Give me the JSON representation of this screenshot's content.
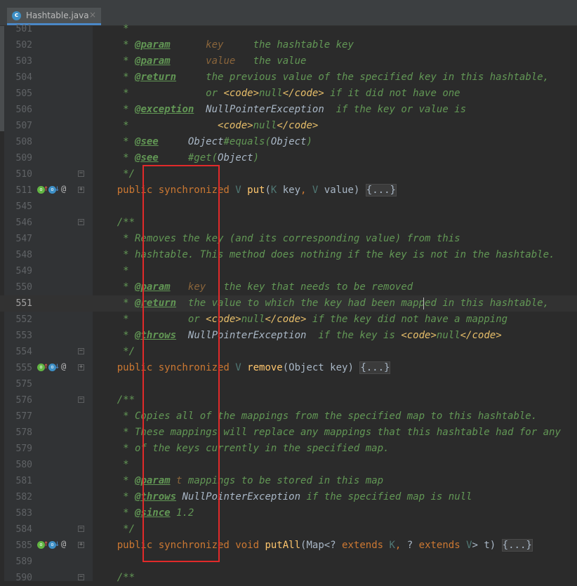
{
  "tab": {
    "filename": "Hashtable.java",
    "icon": "java-class-icon",
    "close": "×"
  },
  "colors": {
    "comment": "#629755",
    "keyword": "#cc7832",
    "method": "#ffc66d",
    "param": "#8a653b",
    "html_tag": "#e8bf6a",
    "highlight_box": "#e12a2a"
  },
  "lines": [
    {
      "num": "501",
      "tokens": [
        {
          "t": "     *",
          "c": "c"
        }
      ]
    },
    {
      "num": "502",
      "tokens": [
        {
          "t": "     * ",
          "c": "c"
        },
        {
          "t": "@param",
          "c": "tag"
        },
        {
          "t": "      ",
          "c": "c"
        },
        {
          "t": "key",
          "c": "pn"
        },
        {
          "t": "     the hashtable key",
          "c": "c"
        }
      ]
    },
    {
      "num": "503",
      "tokens": [
        {
          "t": "     * ",
          "c": "c"
        },
        {
          "t": "@param",
          "c": "tag"
        },
        {
          "t": "      ",
          "c": "c"
        },
        {
          "t": "value",
          "c": "pn"
        },
        {
          "t": "   the value",
          "c": "c"
        }
      ]
    },
    {
      "num": "504",
      "tokens": [
        {
          "t": "     * ",
          "c": "c"
        },
        {
          "t": "@return",
          "c": "tag"
        },
        {
          "t": "     the previous value of the specified key in this hashtable,",
          "c": "c"
        }
      ]
    },
    {
      "num": "505",
      "tokens": [
        {
          "t": "     *             or ",
          "c": "c"
        },
        {
          "t": "<code>",
          "c": "ht"
        },
        {
          "t": "null",
          "c": "c"
        },
        {
          "t": "</code>",
          "c": "ht"
        },
        {
          "t": " if it did not have one",
          "c": "c"
        }
      ]
    },
    {
      "num": "506",
      "tokens": [
        {
          "t": "     * ",
          "c": "c"
        },
        {
          "t": "@exception",
          "c": "tag"
        },
        {
          "t": "  ",
          "c": "c"
        },
        {
          "t": "NullPointerException",
          "c": "ref"
        },
        {
          "t": "  if the key or value is",
          "c": "c"
        }
      ]
    },
    {
      "num": "507",
      "tokens": [
        {
          "t": "     *               ",
          "c": "c"
        },
        {
          "t": "<code>",
          "c": "ht"
        },
        {
          "t": "null",
          "c": "c"
        },
        {
          "t": "</code>",
          "c": "ht"
        }
      ]
    },
    {
      "num": "508",
      "tokens": [
        {
          "t": "     * ",
          "c": "c"
        },
        {
          "t": "@see",
          "c": "tag"
        },
        {
          "t": "     ",
          "c": "c"
        },
        {
          "t": "Object",
          "c": "ref"
        },
        {
          "t": "#equals(",
          "c": "c"
        },
        {
          "t": "Object",
          "c": "ref"
        },
        {
          "t": ")",
          "c": "c"
        }
      ]
    },
    {
      "num": "509",
      "tokens": [
        {
          "t": "     * ",
          "c": "c"
        },
        {
          "t": "@see",
          "c": "tag"
        },
        {
          "t": "     #get(",
          "c": "c"
        },
        {
          "t": "Object",
          "c": "ref"
        },
        {
          "t": ")",
          "c": "c"
        }
      ]
    },
    {
      "num": "510",
      "fold": "−",
      "tokens": [
        {
          "t": "     */",
          "c": "c"
        }
      ]
    },
    {
      "num": "511",
      "icons": true,
      "fold": "+",
      "tokens": [
        {
          "t": "    public ",
          "c": "kw"
        },
        {
          "t": "synchronized ",
          "c": "kw"
        },
        {
          "t": "V ",
          "c": "tp"
        },
        {
          "t": "put",
          "c": "fn"
        },
        {
          "t": "(",
          "c": "plain"
        },
        {
          "t": "K ",
          "c": "tp"
        },
        {
          "t": "key",
          "c": "plain"
        },
        {
          "t": ", ",
          "c": "kw"
        },
        {
          "t": "V ",
          "c": "tp"
        },
        {
          "t": "value) ",
          "c": "plain"
        },
        {
          "t": "{...}",
          "c": "ph"
        }
      ]
    },
    {
      "num": "545",
      "tokens": []
    },
    {
      "num": "546",
      "fold": "−",
      "tokens": [
        {
          "t": "    /**",
          "c": "c"
        }
      ]
    },
    {
      "num": "547",
      "tokens": [
        {
          "t": "     * Removes the key (and its corresponding value) from this",
          "c": "c"
        }
      ]
    },
    {
      "num": "548",
      "tokens": [
        {
          "t": "     * hashtable. This method does nothing if the key is not in the hashtable.",
          "c": "c"
        }
      ]
    },
    {
      "num": "549",
      "tokens": [
        {
          "t": "     *",
          "c": "c"
        }
      ]
    },
    {
      "num": "550",
      "tokens": [
        {
          "t": "     * ",
          "c": "c"
        },
        {
          "t": "@param",
          "c": "tag"
        },
        {
          "t": "   ",
          "c": "c"
        },
        {
          "t": "key",
          "c": "pn"
        },
        {
          "t": "   the key that needs to be removed",
          "c": "c"
        }
      ]
    },
    {
      "num": "551",
      "current": true,
      "tokens": [
        {
          "t": "     * ",
          "c": "c"
        },
        {
          "t": "@return",
          "c": "tag"
        },
        {
          "t": "  the value to which the key had been mapped in this hashtable,",
          "c": "c"
        }
      ]
    },
    {
      "num": "552",
      "tokens": [
        {
          "t": "     *          or ",
          "c": "c"
        },
        {
          "t": "<code>",
          "c": "ht"
        },
        {
          "t": "null",
          "c": "c"
        },
        {
          "t": "</code>",
          "c": "ht"
        },
        {
          "t": " if the key did not have a mapping",
          "c": "c"
        }
      ]
    },
    {
      "num": "553",
      "tokens": [
        {
          "t": "     * ",
          "c": "c"
        },
        {
          "t": "@throws",
          "c": "tag"
        },
        {
          "t": "  ",
          "c": "c"
        },
        {
          "t": "NullPointerException",
          "c": "ref"
        },
        {
          "t": "  if the key is ",
          "c": "c"
        },
        {
          "t": "<code>",
          "c": "ht"
        },
        {
          "t": "null",
          "c": "c"
        },
        {
          "t": "</code>",
          "c": "ht"
        }
      ]
    },
    {
      "num": "554",
      "fold": "−",
      "tokens": [
        {
          "t": "     */",
          "c": "c"
        }
      ]
    },
    {
      "num": "555",
      "icons": true,
      "fold": "+",
      "tokens": [
        {
          "t": "    public ",
          "c": "kw"
        },
        {
          "t": "synchronized ",
          "c": "kw"
        },
        {
          "t": "V ",
          "c": "tp"
        },
        {
          "t": "remove",
          "c": "fn"
        },
        {
          "t": "(Object key) ",
          "c": "plain"
        },
        {
          "t": "{...}",
          "c": "ph"
        }
      ]
    },
    {
      "num": "575",
      "tokens": []
    },
    {
      "num": "576",
      "fold": "−",
      "tokens": [
        {
          "t": "    /**",
          "c": "c"
        }
      ]
    },
    {
      "num": "577",
      "tokens": [
        {
          "t": "     * Copies all of the mappings from the specified map to this hashtable.",
          "c": "c"
        }
      ]
    },
    {
      "num": "578",
      "tokens": [
        {
          "t": "     * These mappings will replace any mappings that this hashtable had for any",
          "c": "c"
        }
      ]
    },
    {
      "num": "579",
      "tokens": [
        {
          "t": "     * of the keys currently in the specified map.",
          "c": "c"
        }
      ]
    },
    {
      "num": "580",
      "tokens": [
        {
          "t": "     *",
          "c": "c"
        }
      ]
    },
    {
      "num": "581",
      "tokens": [
        {
          "t": "     * ",
          "c": "c"
        },
        {
          "t": "@param",
          "c": "tag"
        },
        {
          "t": " ",
          "c": "c"
        },
        {
          "t": "t",
          "c": "pn"
        },
        {
          "t": " mappings to be stored in this map",
          "c": "c"
        }
      ]
    },
    {
      "num": "582",
      "tokens": [
        {
          "t": "     * ",
          "c": "c"
        },
        {
          "t": "@throws",
          "c": "tag"
        },
        {
          "t": " ",
          "c": "c"
        },
        {
          "t": "NullPointerException",
          "c": "ref"
        },
        {
          "t": " if the specified map is null",
          "c": "c"
        }
      ]
    },
    {
      "num": "583",
      "tokens": [
        {
          "t": "     * ",
          "c": "c"
        },
        {
          "t": "@since",
          "c": "tag"
        },
        {
          "t": " 1.2",
          "c": "c"
        }
      ]
    },
    {
      "num": "584",
      "fold": "−",
      "tokens": [
        {
          "t": "     */",
          "c": "c"
        }
      ]
    },
    {
      "num": "585",
      "icons": true,
      "fold": "+",
      "tokens": [
        {
          "t": "    public ",
          "c": "kw"
        },
        {
          "t": "synchronized ",
          "c": "kw"
        },
        {
          "t": "void ",
          "c": "kw"
        },
        {
          "t": "putAll",
          "c": "fn"
        },
        {
          "t": "(Map<? ",
          "c": "plain"
        },
        {
          "t": "extends ",
          "c": "kw"
        },
        {
          "t": "K",
          "c": "tp"
        },
        {
          "t": ", ",
          "c": "kw"
        },
        {
          "t": "? ",
          "c": "plain"
        },
        {
          "t": "extends ",
          "c": "kw"
        },
        {
          "t": "V",
          "c": "tp"
        },
        {
          "t": "> t) ",
          "c": "plain"
        },
        {
          "t": "{...}",
          "c": "ph"
        }
      ]
    },
    {
      "num": "589",
      "tokens": []
    },
    {
      "num": "590",
      "fold": "−",
      "tokens": [
        {
          "t": "    /**",
          "c": "c"
        }
      ]
    }
  ],
  "gutter_icons": {
    "override": "o",
    "implements": "↑",
    "implemented_by": "↓",
    "annotation": "@"
  }
}
